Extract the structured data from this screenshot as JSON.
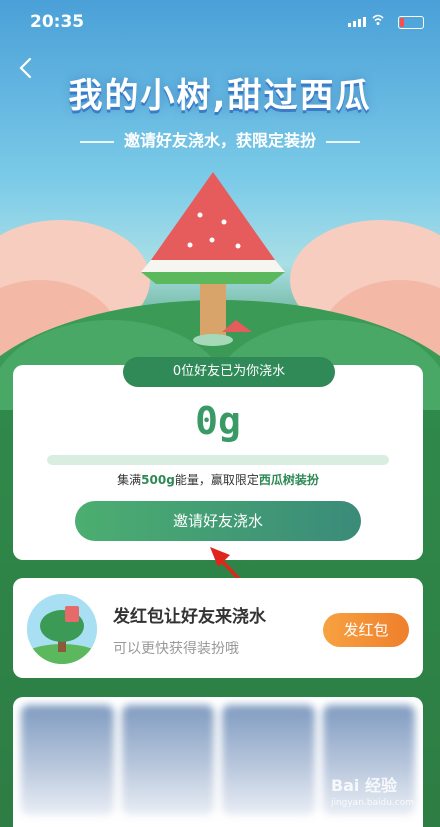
{
  "status": {
    "time": "20:35"
  },
  "hero": {
    "title": "我的小树,甜过西瓜",
    "subtitle": "邀请好友浇水，获限定装扮"
  },
  "progress_card": {
    "friends_watered": "0位好友已为你浇水",
    "grams": "0g",
    "progress_fraction": 0,
    "desc_prefix": "集满",
    "desc_amount": "500g",
    "desc_middle": "能量，赢取限定",
    "desc_reward": "西瓜树装扮",
    "invite_button": "邀请好友浇水"
  },
  "redpack_card": {
    "title": "发红包让好友来浇水",
    "subtitle": "可以更快获得装扮哦",
    "button": "发红包"
  },
  "watermark": {
    "brand": "Bai 经验",
    "url": "jingyan.baidu.com"
  },
  "colors": {
    "accent_green": "#3a9a66",
    "orange": "#ef7f2c",
    "tab_green": "#2f8a57"
  }
}
